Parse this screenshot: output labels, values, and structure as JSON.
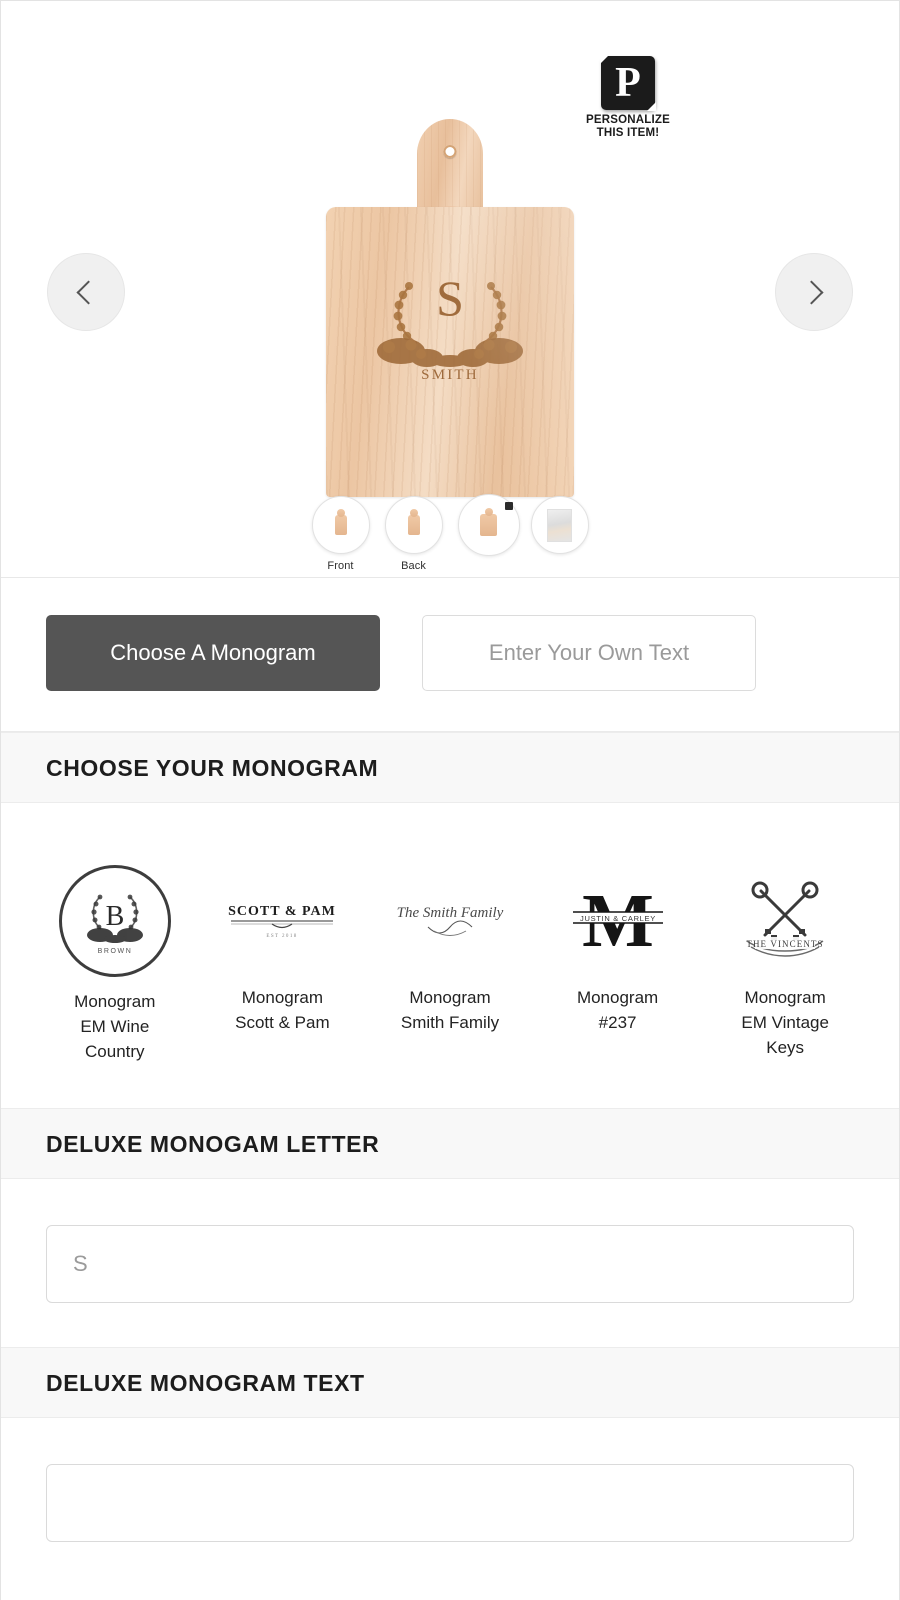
{
  "badge": {
    "mark_letter": "P",
    "line1": "PERSONALIZE",
    "line2": "THIS ITEM!"
  },
  "viewer": {
    "prev_icon": "chevron-left-icon",
    "next_icon": "chevron-right-icon",
    "product_engraving": {
      "monogram_letter": "S",
      "family_name": "SMITH"
    },
    "thumbnails": [
      {
        "label": "Front",
        "icon": "cutting-board-front-icon",
        "selected": false
      },
      {
        "label": "Back",
        "icon": "cutting-board-back-icon",
        "selected": false
      },
      {
        "label": "",
        "icon": "cutting-board-detail-icon",
        "selected": true
      },
      {
        "label": "",
        "icon": "lifestyle-photo-icon",
        "selected": false
      }
    ]
  },
  "tabs": [
    {
      "label": "Choose A Monogram",
      "active": true
    },
    {
      "label": "Enter Your Own Text",
      "active": false
    }
  ],
  "sections": {
    "choose_monogram": {
      "title": "CHOOSE YOUR MONOGRAM",
      "options": [
        {
          "label_line1": "Monogram",
          "label_line2": "EM Wine",
          "label_line3": "Country",
          "art": "wreath-letter-b-brown",
          "art_letter": "B",
          "art_name": "BROWN",
          "selected": true
        },
        {
          "label_line1": "Monogram",
          "label_line2": "Scott & Pam",
          "label_line3": "",
          "art": "scott-and-pam-nameplate",
          "art_text": "SCOTT & PAM",
          "selected": false
        },
        {
          "label_line1": "Monogram",
          "label_line2": "Smith Family",
          "label_line3": "",
          "art": "smith-family-script",
          "art_text": "The Smith Family",
          "selected": false
        },
        {
          "label_line1": "Monogram",
          "label_line2": "#237",
          "label_line3": "",
          "art": "split-letter-m",
          "art_letter": "M",
          "art_text": "JUSTIN & CARLEY",
          "selected": false
        },
        {
          "label_line1": "Monogram",
          "label_line2": "EM Vintage",
          "label_line3": "Keys",
          "art": "crossed-keys-the-vincents",
          "art_text": "THE VINCENTS",
          "selected": false
        }
      ]
    },
    "deluxe_letter": {
      "title": "DELUXE MONOGAM LETTER",
      "input_value": "S",
      "input_placeholder": "S"
    },
    "deluxe_text": {
      "title": "DELUXE MONOGRAM TEXT",
      "input_value": "",
      "input_placeholder": ""
    }
  },
  "colors": {
    "active_tab_bg": "#555555",
    "section_header_bg": "#f8f8f8",
    "wood_light": "#f2d2b2",
    "wood_dark": "#e4b68f",
    "engrave": "#9e6a3c"
  }
}
